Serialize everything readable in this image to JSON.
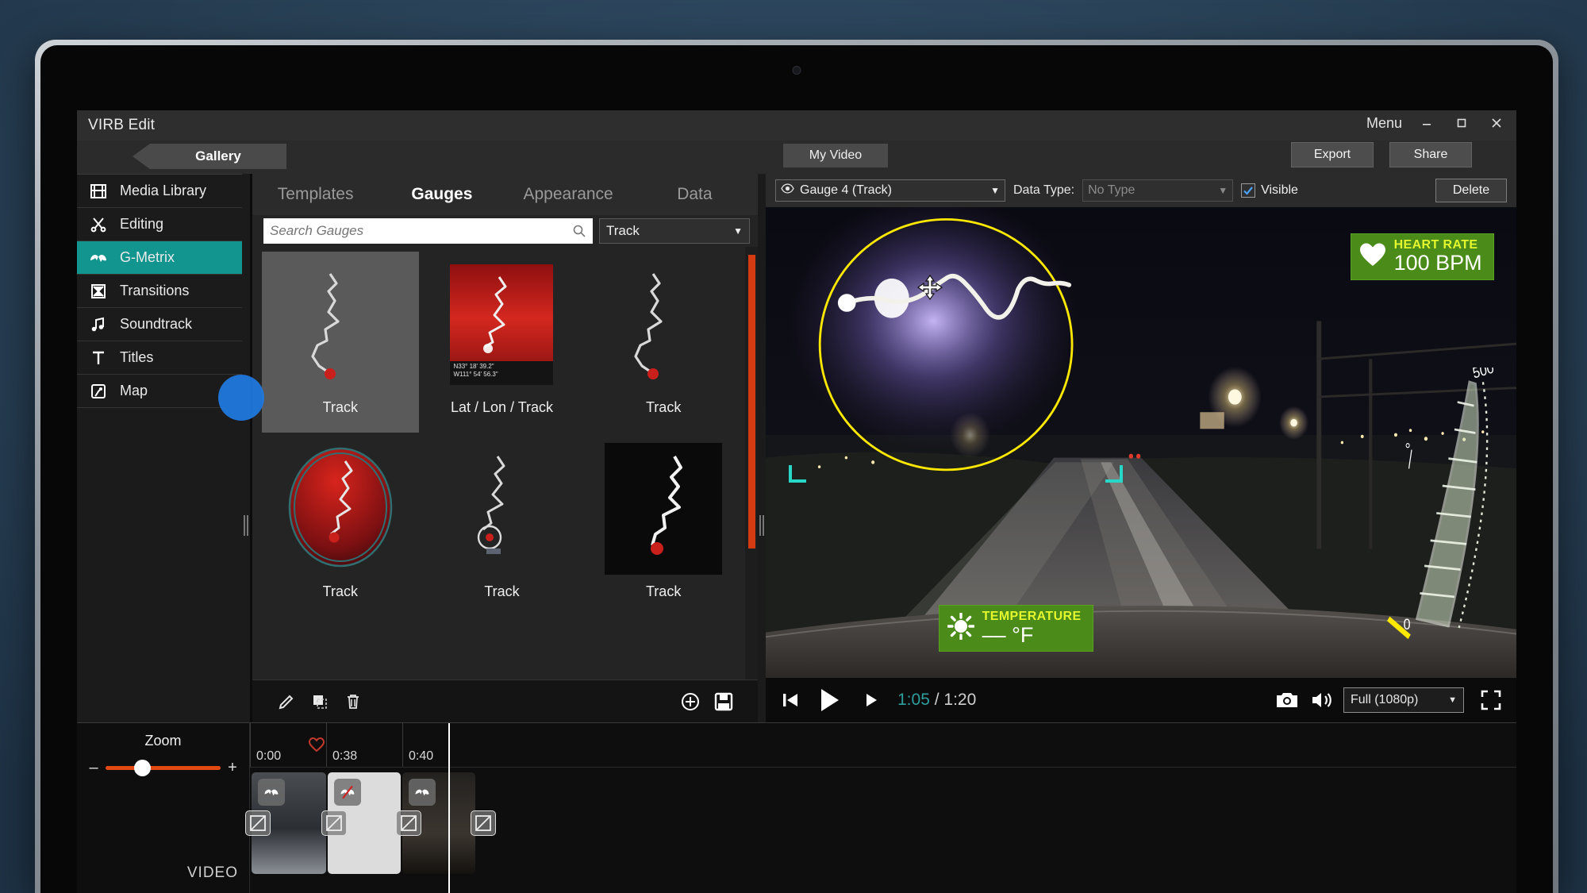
{
  "window": {
    "app_title": "VIRB Edit",
    "menu_label": "Menu",
    "minimize_icon": "minimize-icon",
    "maximize_icon": "maximize-icon",
    "close_icon": "close-icon",
    "gallery_tab": "Gallery",
    "my_video_tab": "My Video",
    "export_label": "Export",
    "share_label": "Share"
  },
  "sidebar": {
    "items": [
      {
        "label": "Media Library",
        "icon": "film-strip-icon",
        "active": false
      },
      {
        "label": "Editing",
        "icon": "scissors-icon",
        "active": false
      },
      {
        "label": "G-Metrix",
        "icon": "pulse-icon",
        "active": true
      },
      {
        "label": "Transitions",
        "icon": "hourglass-icon",
        "active": false
      },
      {
        "label": "Soundtrack",
        "icon": "music-note-icon",
        "active": false
      },
      {
        "label": "Titles",
        "icon": "text-t-icon",
        "active": false
      },
      {
        "label": "Map",
        "icon": "map-icon",
        "active": false
      }
    ]
  },
  "gauge_panel": {
    "tabs": [
      {
        "label": "Templates",
        "active": false
      },
      {
        "label": "Gauges",
        "active": true
      },
      {
        "label": "Appearance",
        "active": false
      },
      {
        "label": "Data",
        "active": false
      }
    ],
    "search": {
      "placeholder": "Search Gauges",
      "value": "",
      "icon": "search-icon"
    },
    "category_filter": {
      "value": "Track",
      "caret": "▼"
    },
    "gauges": [
      {
        "label": "Track",
        "style": "gray-card",
        "selected": true
      },
      {
        "label": "Lat / Lon / Track",
        "style": "red-card",
        "selected": false,
        "coord_lat": "N33° 18' 39.2\"",
        "coord_lon": "W111° 54' 56.3\""
      },
      {
        "label": "Track",
        "style": "plain",
        "selected": false
      },
      {
        "label": "Track",
        "style": "red-circle",
        "selected": false
      },
      {
        "label": "Track",
        "style": "plain-compass",
        "selected": false
      },
      {
        "label": "Track",
        "style": "black-card",
        "selected": false
      }
    ],
    "toolbar": {
      "edit_label": "Edit",
      "duplicate_label": "Duplicate",
      "delete_label": "Delete",
      "add_label": "Add",
      "save_label": "Save"
    }
  },
  "gauge_bar": {
    "selected_gauge": "Gauge 4 (Track)",
    "eye_icon": "eye-icon",
    "caret": "▼",
    "data_type_label": "Data Type:",
    "data_type_value": "No Type",
    "visible_label": "Visible",
    "visible_checked": true,
    "delete_label": "Delete"
  },
  "video_overlays": {
    "heart_rate": {
      "title": "HEART RATE",
      "value": "100 BPM",
      "icon": "heart-icon",
      "color": "#4a8b1a"
    },
    "temperature": {
      "title": "TEMPERATURE",
      "value": "–– °F",
      "icon": "sun-icon",
      "color": "#4a8b1a"
    },
    "elevation": {
      "max": "500",
      "min": "0",
      "value": "––°"
    },
    "track_gauge": {
      "selection_color": "#ffe800",
      "handle_color": "#27d7c8"
    }
  },
  "player": {
    "prev_frame_icon": "step-back-icon",
    "play_icon": "play-icon",
    "next_frame_icon": "step-forward-icon",
    "current_time": "1:05",
    "separator": "/",
    "total_time": "1:20",
    "snapshot_icon": "camera-icon",
    "volume_icon": "speaker-icon",
    "resolution": "Full (1080p)",
    "resolution_caret": "▼",
    "fullscreen_icon": "fullscreen-icon"
  },
  "timeline": {
    "zoom_label": "Zoom",
    "zoom_minus": "–",
    "zoom_plus": "+",
    "track_label": "VIDEO",
    "ticks": [
      "0:00",
      "0:38",
      "0:40"
    ],
    "heart_marker_icon": "heart-small-icon",
    "clips": [
      {
        "badge_icon": "gmetrix-icon",
        "badge_state": "on"
      },
      {
        "badge_icon": "gmetrix-off-icon",
        "badge_state": "off"
      },
      {
        "badge_icon": "gmetrix-icon",
        "badge_state": "on"
      }
    ],
    "transition_icon": "transition-icon"
  }
}
